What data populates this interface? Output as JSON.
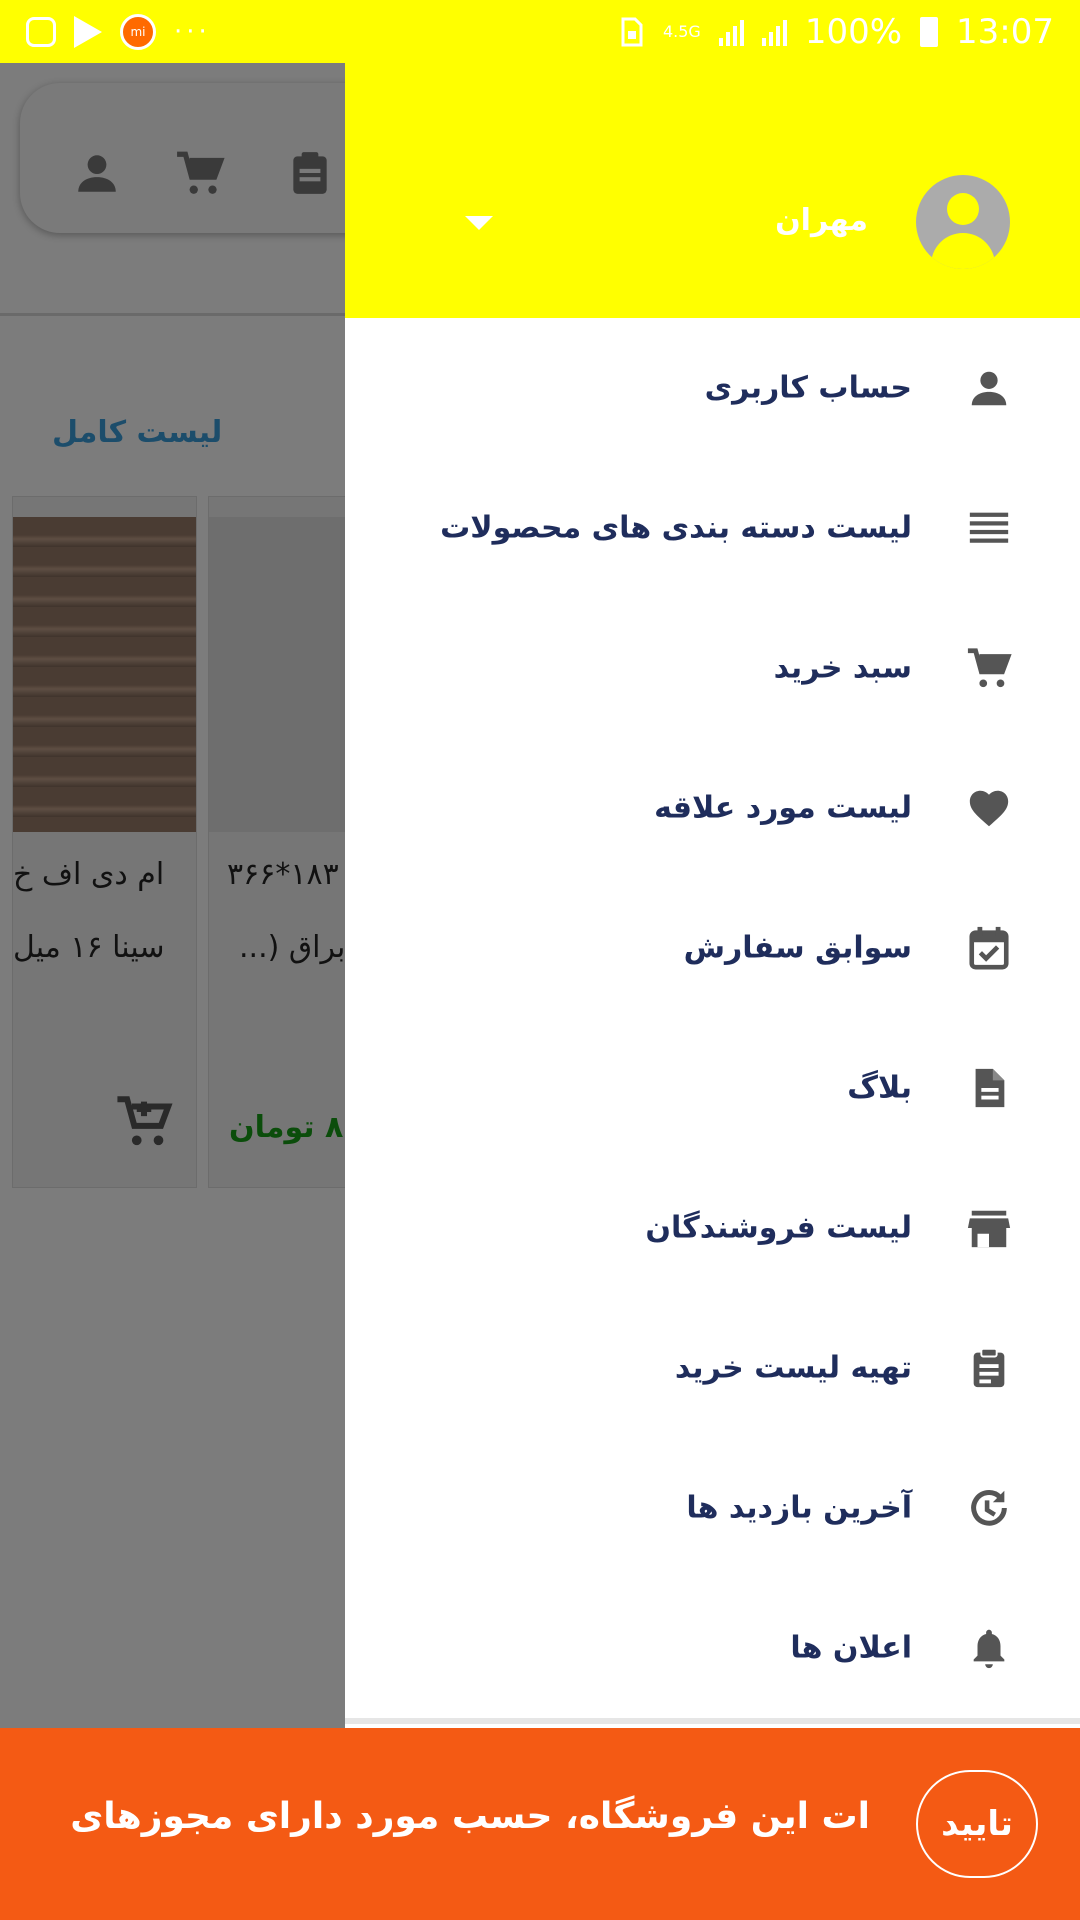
{
  "status_bar": {
    "network": "4.5G",
    "battery": "100%",
    "time": "13:07",
    "notification_icons": [
      "instagram-icon",
      "play-store-icon",
      "mi-icon"
    ],
    "more": "···"
  },
  "background": {
    "full_list_link": "لیست کامل",
    "cards": [
      {
        "title_line1": "ام دی اف خ",
        "title_line2": "سینا ۱۶ میل",
        "action_icon": "add-to-cart-icon"
      },
      {
        "title_line1": "۱۸۳*۳۶۶",
        "title_line2": "براق (...",
        "price": "۸ تومان"
      }
    ],
    "toolbar_icons": [
      "person-icon",
      "cart-icon",
      "clipboard-icon"
    ]
  },
  "drawer": {
    "user_name": "مهران",
    "menu": [
      {
        "label": "حساب کاربری",
        "icon": "person-icon"
      },
      {
        "label": "لیست دسته بندی های محصولات",
        "icon": "list-icon"
      },
      {
        "label": "سبد خرید",
        "icon": "cart-icon"
      },
      {
        "label": "لیست مورد علاقه",
        "icon": "heart-icon"
      },
      {
        "label": "سوابق سفارش",
        "icon": "calendar-check-icon"
      },
      {
        "label": "بلاگ",
        "icon": "document-icon"
      },
      {
        "label": "لیست فروشندگان",
        "icon": "store-icon"
      },
      {
        "label": "تهیه لیست خرید",
        "icon": "clipboard-icon"
      },
      {
        "label": "آخرین بازدید ها",
        "icon": "history-icon"
      },
      {
        "label": "اعلان ها",
        "icon": "bell-icon"
      }
    ]
  },
  "banner": {
    "text": "ات این فروشگاه، حسب مورد دارای مجوزهای",
    "confirm_label": "تایید"
  },
  "colors": {
    "header_yellow": "#ffff00",
    "banner_orange": "#f45a14",
    "menu_text": "#1f2d5c",
    "icon_gray": "#555555"
  }
}
